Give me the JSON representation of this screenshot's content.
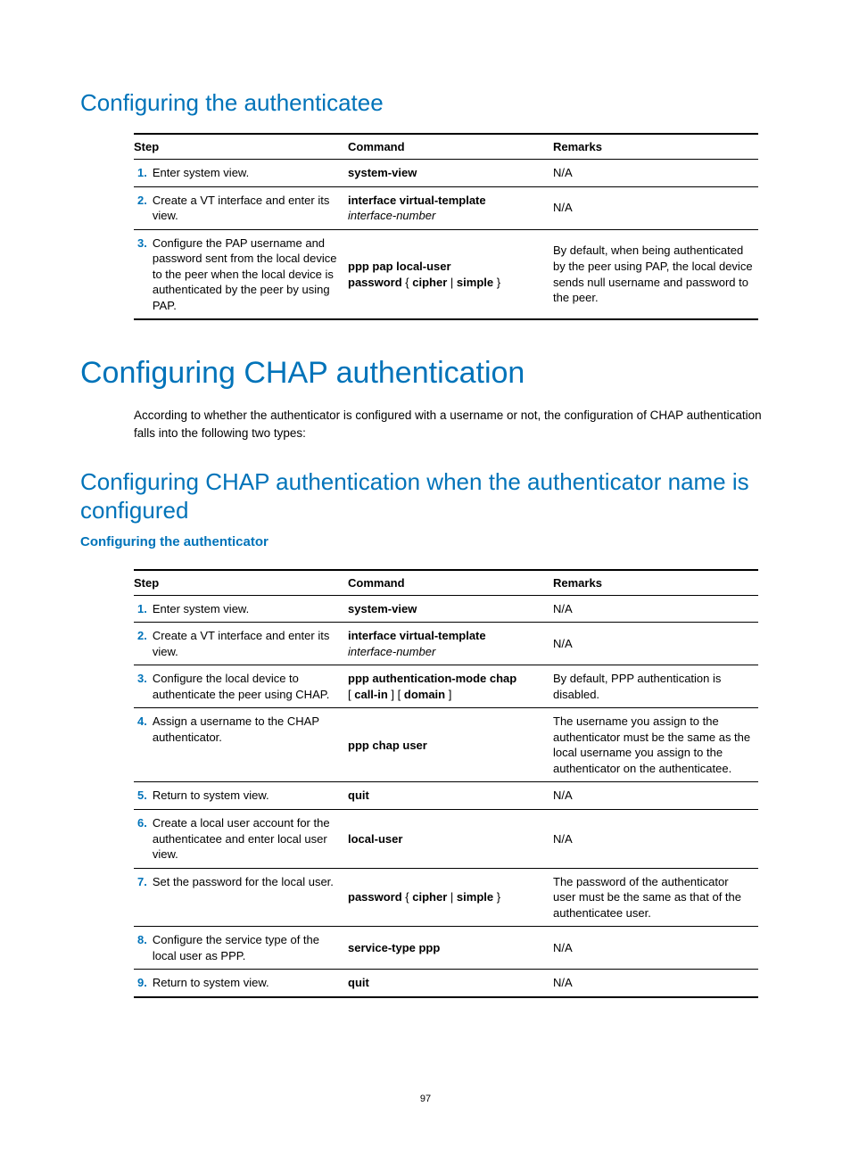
{
  "page_number": "97",
  "headings": {
    "h2_authenticatee": "Configuring the authenticatee",
    "h1_chap": "Configuring CHAP authentication",
    "chap_intro": "According to whether the authenticator is configured with a username or not, the configuration of CHAP authentication falls into the following two types:",
    "h2_chap_name": "Configuring CHAP authentication when the authenticator name is configured",
    "h3_authenticator": "Configuring the authenticator"
  },
  "table_headers": {
    "step": "Step",
    "command": "Command",
    "remarks": "Remarks"
  },
  "table1": {
    "rows": [
      {
        "num": "1.",
        "desc": "Enter system view.",
        "cmd_bold": "system-view",
        "cmd_ital": "",
        "remarks": "N/A"
      },
      {
        "num": "2.",
        "desc": "Create a VT interface and enter its view.",
        "cmd_bold": "interface virtual-template",
        "cmd_ital": "interface-number",
        "remarks": "N/A"
      },
      {
        "num": "3.",
        "desc": "Configure the PAP username and password sent from the local device to the peer when the local device is authenticated by the peer by using PAP.",
        "cmd_bold_a": "ppp pap local-user",
        "cmd_bold_b": "password",
        "cmd_bold_c": "cipher",
        "cmd_bold_d": "simple",
        "cmd_sep": "|",
        "remarks": "By default, when being authenticated by the peer using PAP, the local device sends null username and password to the peer."
      }
    ]
  },
  "table2": {
    "rows": [
      {
        "num": "1.",
        "desc": "Enter system view.",
        "cmd_bold": "system-view",
        "cmd_ital": "",
        "remarks": "N/A"
      },
      {
        "num": "2.",
        "desc": "Create a VT interface and enter its view.",
        "cmd_bold": "interface virtual-template",
        "cmd_ital": "interface-number",
        "remarks": "N/A"
      },
      {
        "num": "3.",
        "desc": "Configure the local device to authenticate the peer using CHAP.",
        "cmd_bold_a": "ppp authentication-mode chap",
        "cmd_bold_b": "call-in",
        "cmd_bold_c": "domain",
        "remarks": "By default, PPP authentication is disabled."
      },
      {
        "num": "4.",
        "desc": "Assign a username to the CHAP authenticator.",
        "cmd_bold": "ppp chap user",
        "cmd_ital": "",
        "remarks": "The username you assign to the authenticator must be the same as the local username you assign to the authenticator on the authenticatee."
      },
      {
        "num": "5.",
        "desc": "Return to system view.",
        "cmd_bold": "quit",
        "cmd_ital": "",
        "remarks": "N/A"
      },
      {
        "num": "6.",
        "desc": "Create a local user account for the authenticatee and enter local user view.",
        "cmd_bold": "local-user",
        "cmd_ital": "",
        "remarks": "N/A"
      },
      {
        "num": "7.",
        "desc": "Set the password for the local user.",
        "cmd_bold_a": "password",
        "cmd_bold_b": "cipher",
        "cmd_bold_c": "simple",
        "cmd_sep": "|",
        "remarks": "The password of the authenticator user must be the same as that of the authenticatee user."
      },
      {
        "num": "8.",
        "desc": "Configure the service type of the local user as PPP.",
        "cmd_bold": "service-type ppp",
        "cmd_ital": "",
        "remarks": "N/A"
      },
      {
        "num": "9.",
        "desc": "Return to system view.",
        "cmd_bold": "quit",
        "cmd_ital": "",
        "remarks": "N/A"
      }
    ]
  }
}
